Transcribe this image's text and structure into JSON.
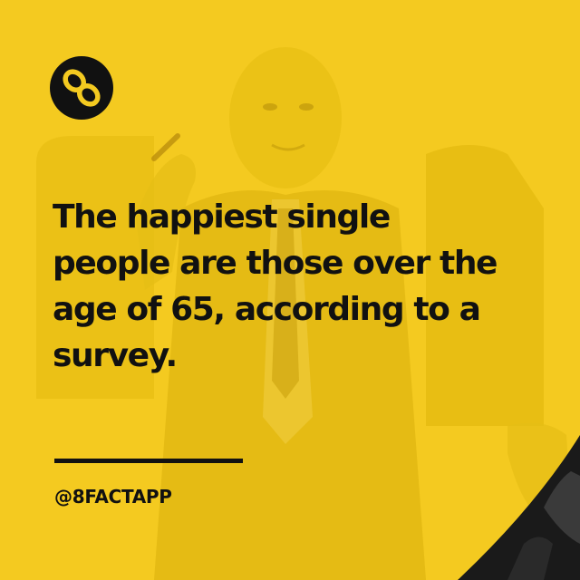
{
  "brand": {
    "logo_icon": "infinity-eight-icon",
    "handle": "@8FACTAPP"
  },
  "fact": {
    "lines": [
      "The happiest single",
      "people are those over the",
      "age of 65, according to a",
      "survey."
    ]
  },
  "colors": {
    "background_yellow": "#f4ca20",
    "text": "#111111",
    "corner_dark": "#1a1a1a"
  },
  "photo": {
    "subject": "portrait-photo"
  }
}
